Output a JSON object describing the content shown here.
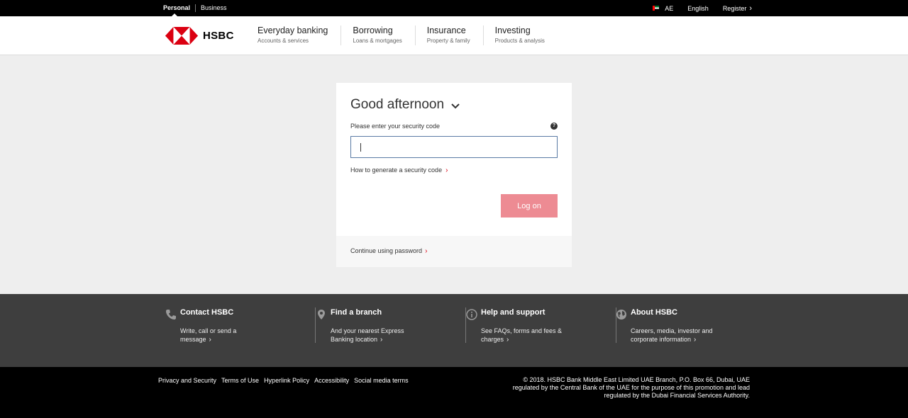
{
  "topbar": {
    "tabs": [
      "Personal",
      "Business"
    ],
    "location": "AE",
    "language": "English",
    "register": "Register"
  },
  "header": {
    "logo_text": "HSBC",
    "nav": [
      {
        "title": "Everyday banking",
        "sub": "Accounts & services"
      },
      {
        "title": "Borrowing",
        "sub": "Loans & mortgages"
      },
      {
        "title": "Insurance",
        "sub": "Property & family"
      },
      {
        "title": "Investing",
        "sub": "Products & analysis"
      }
    ]
  },
  "login": {
    "greeting": "Good afternoon",
    "field_label": "Please enter your security code",
    "help_symbol": "?",
    "input_value": "",
    "how_link": "How to generate a security code",
    "logon_button": "Log on",
    "password_link": "Continue using password"
  },
  "footer": {
    "columns": [
      {
        "title": "Contact HSBC",
        "desc": "Write, call or send a message",
        "icon": "phone-icon"
      },
      {
        "title": "Find a branch",
        "desc": "And your nearest Express Banking location",
        "icon": "location-pin-icon"
      },
      {
        "title": "Help and support",
        "desc": "See FAQs, forms and fees & charges",
        "icon": "info-icon"
      },
      {
        "title": "About HSBC",
        "desc": "Careers, media, investor and corporate information",
        "icon": "globe-icon"
      }
    ],
    "links": [
      "Privacy and Security",
      "Terms of Use",
      "Hyperlink Policy",
      "Accessibility",
      "Social media terms"
    ],
    "copyright": "© 2018. HSBC Bank Middle East Limited UAE Branch, P.O. Box 66, Dubai, UAE regulated by the Central Bank of the UAE for the purpose of this promotion and lead regulated by the Dubai Financial Services Authority."
  },
  "colors": {
    "brand_red": "#db0011",
    "logon_button": "#ed8b93",
    "footer_bg": "#3e3e3e"
  }
}
